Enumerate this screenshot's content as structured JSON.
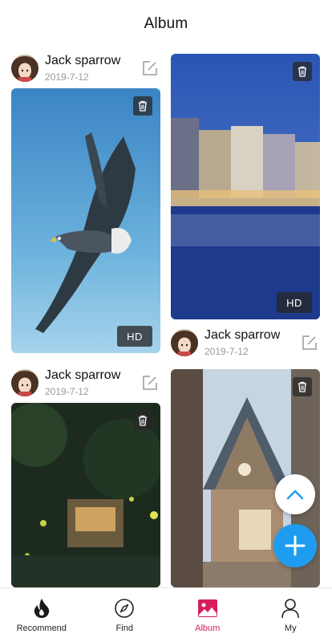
{
  "header": {
    "title": "Album"
  },
  "posts": {
    "left_top": {
      "username": "Jack sparrow",
      "date": "2019-7-12",
      "hd": "HD"
    },
    "right_middle": {
      "username": "Jack sparrow",
      "date": "2019-7-12"
    },
    "left_bottom": {
      "username": "Jack sparrow",
      "date": "2019-7-12"
    },
    "right_top": {
      "hd": "HD"
    }
  },
  "tabbar": {
    "items": [
      {
        "label": "Recommend",
        "icon": "flame-icon"
      },
      {
        "label": "Find",
        "icon": "compass-icon"
      },
      {
        "label": "Album",
        "icon": "image-icon",
        "active": true
      },
      {
        "label": "My",
        "icon": "person-icon"
      }
    ]
  },
  "colors": {
    "accent": "#d81e5b",
    "fab_blue": "#1e9df0"
  }
}
